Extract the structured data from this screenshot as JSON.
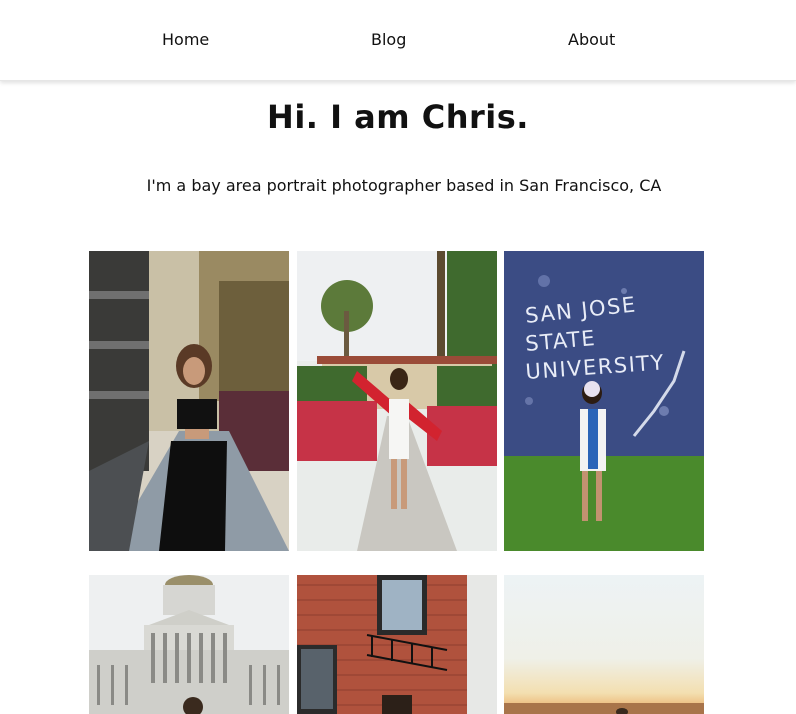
{
  "nav": {
    "items": [
      {
        "label": "Home"
      },
      {
        "label": "Blog"
      },
      {
        "label": "About"
      }
    ]
  },
  "hero": {
    "title": "Hi. I am Chris.",
    "subtitle": "I'm a bay area portrait photographer based in San Francisco, CA"
  },
  "gallery": {
    "photo3_sign": [
      "SAN JOSE",
      "STATE",
      "UNIVERSITY"
    ]
  }
}
